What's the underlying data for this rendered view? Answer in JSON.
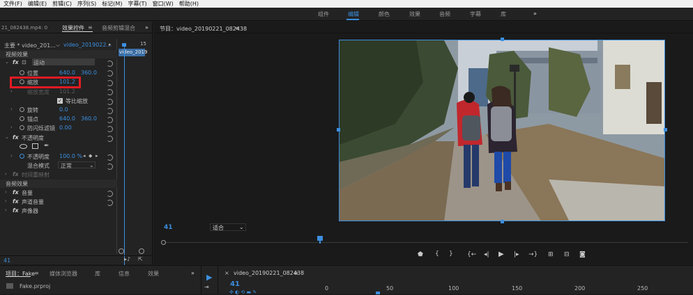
{
  "menu": [
    "文件(F)",
    "编辑(E)",
    "剪辑(C)",
    "序列(S)",
    "标记(M)",
    "字幕(T)",
    "窗口(W)",
    "帮助(H)"
  ],
  "workspaces": [
    {
      "label": "组件",
      "active": false
    },
    {
      "label": "编辑",
      "active": true
    },
    {
      "label": "颜色",
      "active": false
    },
    {
      "label": "效果",
      "active": false
    },
    {
      "label": "音频",
      "active": false
    },
    {
      "label": "字幕",
      "active": false
    },
    {
      "label": "库",
      "active": false
    }
  ],
  "workspace_more": "»",
  "left": {
    "source_tab": "21_082438.mp4: 0",
    "tab_effect": "效果控件",
    "tab_menu": "≡",
    "tab_audio": "音频剪辑混合",
    "tab_more": "»",
    "master": "主要 * video_201...",
    "clip": "video_2019022...",
    "timebar_clip": "video_2019",
    "timebar_num": "15",
    "video_effects": "视频效果",
    "motion": "运动",
    "position_label": "位置",
    "position_x": "640.0",
    "position_y": "360.0",
    "scale_label": "缩放",
    "scale_value": "101.2",
    "scale_width_label": "缩放宽度",
    "scale_width_value": "101.2",
    "uniform_label": "等比缩放",
    "rotation_label": "旋转",
    "rotation_value": "0.0",
    "anchor_label": "锚点",
    "anchor_x": "640.0",
    "anchor_y": "360.0",
    "flicker_label": "防闪烁滤镜",
    "flicker_value": "0.00",
    "opacity": "不透明度",
    "opacity_label": "不透明度",
    "opacity_value": "100.0 %",
    "blend_label": "混合模式",
    "blend_value": "正常",
    "time_remap": "时间重映射",
    "audio_effects": "音频效果",
    "volume": "音量",
    "channel_volume": "声道音量",
    "panner": "声像器",
    "timecode": "41"
  },
  "monitor": {
    "title": "节目：video_20190221_082438",
    "menu": "≡",
    "timecode": "41",
    "fit": "适合"
  },
  "bottom": {
    "tabs": [
      "项目：Fake",
      "媒体浏览器",
      "库",
      "信息",
      "效果"
    ],
    "tab_menu": "≡",
    "more": "»",
    "project_file": "Fake.prproj",
    "seq_title": "video_20190221_082438",
    "seq_menu": "≡",
    "seq_timecode": "41",
    "ruler": [
      "0",
      "50",
      "100",
      "150",
      "200",
      "250"
    ]
  },
  "colors": {
    "accent": "#3b8fe0",
    "highlight": "#e31b23"
  }
}
